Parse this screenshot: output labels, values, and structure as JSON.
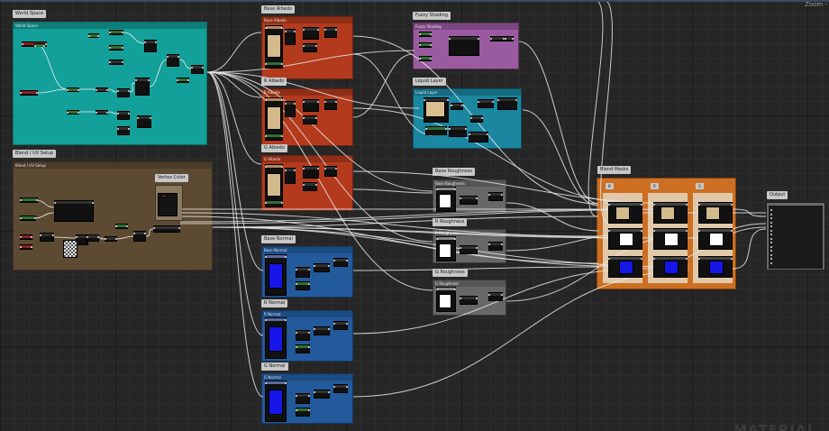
{
  "view": {
    "zoom_label": "Zoom -",
    "watermark": "MATERIAL",
    "colors": {
      "grid_bg": "#262626",
      "teal": "#14a09a",
      "brown": "#5c4a32",
      "red": "#b33a1c",
      "purple": "#9a5aa0",
      "cyan": "#1a86a0",
      "gray": "#676767",
      "blue": "#235a9c",
      "orange": "#cc6f22",
      "wire": "#e8e8e8"
    }
  },
  "groups": {
    "world_space": {
      "title": "World Space",
      "subtitle": "World Space"
    },
    "blend_uv": {
      "title": "Blend / UV Setup",
      "subtitle": "Blend / UV Setup"
    },
    "vertex_color": {
      "title": "Vertex Color"
    },
    "base_albedo": {
      "title": "Base Albedo",
      "subtitle": "Base Albedo"
    },
    "r_albedo": {
      "title": "R Albedo",
      "subtitle": "R Albedo"
    },
    "g_albedo": {
      "title": "G Albedo",
      "subtitle": "G Albedo"
    },
    "fuzzy_shading": {
      "title": "Fuzzy Shading",
      "subtitle": "Fuzzy Shading"
    },
    "liquid_layer": {
      "title": "Liquid Layer",
      "subtitle": "Liquid Layer"
    },
    "base_roughness": {
      "title": "Base Roughness",
      "subtitle": "Base Roughness"
    },
    "r_roughness": {
      "title": "R Roughness",
      "subtitle": "R Roughness"
    },
    "g_roughness": {
      "title": "G Roughness",
      "subtitle": "G Roughness"
    },
    "base_normal": {
      "title": "Base Normal",
      "subtitle": "Base Normal"
    },
    "r_normal": {
      "title": "R Normal",
      "subtitle": "R Normal"
    },
    "g_normal": {
      "title": "G Normal",
      "subtitle": "G Normal"
    },
    "blend_masks": {
      "title": "Blend Masks",
      "columns": [
        "B",
        "R",
        "G"
      ]
    },
    "output": {
      "title": "Output"
    }
  }
}
